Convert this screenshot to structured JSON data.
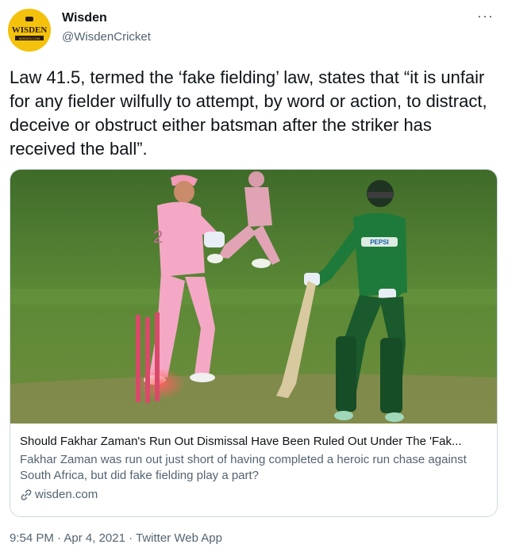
{
  "author": {
    "display_name": "Wisden",
    "handle": "@WisdenCricket",
    "avatar_text": "WISDEN",
    "avatar_subtext": "WISDEN.COM",
    "avatar_color": "#f4c20d"
  },
  "more_icon": "more-icon",
  "tweet": {
    "text": "Law 41.5, termed the ‘fake fielding’ law, states that “it is unfair for any fielder wilfully to attempt, by word or action, to distract, deceive or obstruct either batsman after the striker has received the ball”."
  },
  "card": {
    "title": "Should Fakhar Zaman's Run Out Dismissal Have Been Ruled Out Under The 'Fak...",
    "description": "Fakhar Zaman was run out just short of having completed a heroic run chase against South Africa, but did fake fielding play a part?",
    "domain": "wisden.com",
    "link_icon": "link-icon",
    "image_jersey_text": "PEPSI"
  },
  "meta": {
    "time": "9:54 PM",
    "separator": " · ",
    "date": "Apr 4, 2021",
    "source": "Twitter Web App"
  }
}
